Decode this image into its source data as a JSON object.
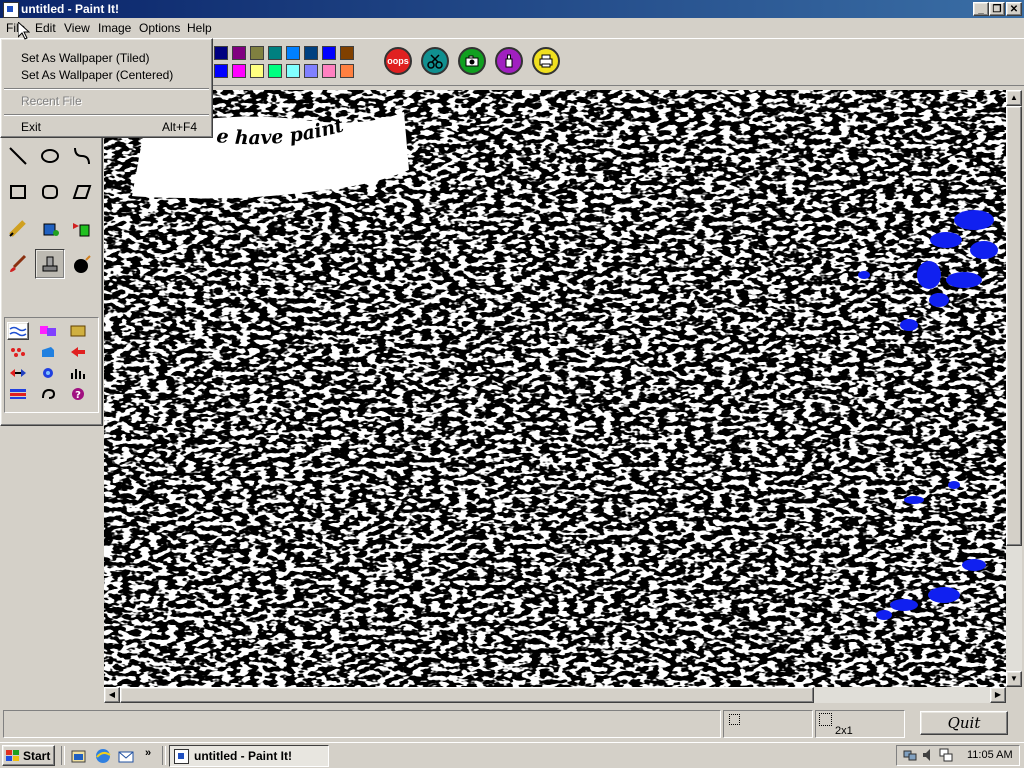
{
  "window": {
    "title": "untitled - Paint It!"
  },
  "menubar": {
    "items": [
      {
        "label": "File"
      },
      {
        "label": "Edit"
      },
      {
        "label": "View"
      },
      {
        "label": "Image"
      },
      {
        "label": "Options"
      },
      {
        "label": "Help"
      }
    ]
  },
  "file_menu": {
    "items": [
      {
        "label": "Set As Wallpaper (Tiled)",
        "shortcut": "",
        "enabled": true
      },
      {
        "label": "Set As Wallpaper (Centered)",
        "shortcut": "",
        "enabled": true
      },
      {
        "label": "Recent File",
        "shortcut": "",
        "enabled": false
      },
      {
        "label": "Exit",
        "shortcut": "Alt+F4",
        "enabled": true
      }
    ]
  },
  "palette": {
    "row1": [
      "#000080",
      "#800080",
      "#808040",
      "#008080",
      "#0080ff",
      "#004080",
      "#0000ff",
      "#804000"
    ],
    "row2": [
      "#0000ff",
      "#ff00ff",
      "#ffff80",
      "#00ff80",
      "#80ffff",
      "#8080ff",
      "#ff80c0",
      "#ff8040"
    ]
  },
  "action_buttons": [
    {
      "icon": "oops-icon",
      "label": "oops",
      "color": "#e02020"
    },
    {
      "icon": "scissors-icon",
      "label": "",
      "color": "#109090"
    },
    {
      "icon": "camera-icon",
      "label": "",
      "color": "#10a020"
    },
    {
      "icon": "paint-bottle-icon",
      "label": "",
      "color": "#a020c0"
    },
    {
      "icon": "printer-icon",
      "label": "",
      "color": "#f0e020"
    }
  ],
  "canvas": {
    "banner_text": "e have paint 2"
  },
  "status": {
    "size_text": "2x1",
    "quit_label": "Quit"
  },
  "taskbar": {
    "start_label": "Start",
    "task_label": "untitled - Paint It!",
    "clock": "11:05 AM"
  }
}
